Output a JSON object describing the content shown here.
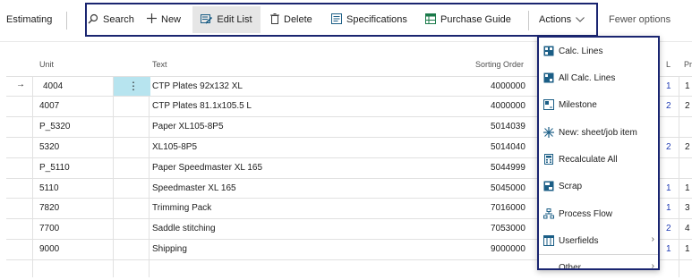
{
  "page": {
    "title": "Estimating"
  },
  "toolbar": {
    "search": "Search",
    "new": "New",
    "edit_list": "Edit List",
    "delete": "Delete",
    "specifications": "Specifications",
    "purchase_guide": "Purchase Guide",
    "actions": "Actions",
    "fewer_options": "Fewer options"
  },
  "columns": {
    "unit": "Unit",
    "text": "Text",
    "sorting_order": "Sorting Order",
    "partial_1": "L",
    "partial_2": "Pr"
  },
  "rows": [
    {
      "arrow": "→",
      "unit": "4004",
      "text": "CTP Plates 92x132 XL",
      "sort": "4000000",
      "c1": "1",
      "c2": "1"
    },
    {
      "arrow": "",
      "unit": "4007",
      "text": "CTP Plates 81.1x105.5 L",
      "sort": "4000000",
      "c1": "2",
      "c2": "2"
    },
    {
      "arrow": "",
      "unit": "P_5320",
      "text": "Paper XL105-8P5",
      "sort": "5014039",
      "c1": "",
      "c2": ""
    },
    {
      "arrow": "",
      "unit": "5320",
      "text": "XL105-8P5",
      "sort": "5014040",
      "c1": "2",
      "c2": "2"
    },
    {
      "arrow": "",
      "unit": "P_5110",
      "text": "Paper Speedmaster XL 165",
      "sort": "5044999",
      "c1": "",
      "c2": ""
    },
    {
      "arrow": "",
      "unit": "5110",
      "text": "Speedmaster XL 165",
      "sort": "5045000",
      "c1": "1",
      "c2": "1"
    },
    {
      "arrow": "",
      "unit": "7820",
      "text": "Trimming Pack",
      "sort": "7016000",
      "c1": "1",
      "c2": "3"
    },
    {
      "arrow": "",
      "unit": "7700",
      "text": "Saddle stitching",
      "sort": "7053000",
      "c1": "2",
      "c2": "4"
    },
    {
      "arrow": "",
      "unit": "9000",
      "text": "Shipping",
      "sort": "9000000",
      "c1": "1",
      "c2": "1"
    }
  ],
  "row_actions_glyph": "⋮",
  "actions_menu": {
    "items": [
      {
        "label": "Calc. Lines",
        "icon": "calc-lines-icon"
      },
      {
        "label": "All Calc. Lines",
        "icon": "all-calc-lines-icon"
      },
      {
        "label": "Milestone",
        "icon": "milestone-icon"
      },
      {
        "label": "New: sheet/job item",
        "icon": "new-sheet-icon"
      },
      {
        "label": "Recalculate All",
        "icon": "recalculate-icon"
      },
      {
        "label": "Scrap",
        "icon": "scrap-icon"
      },
      {
        "label": "Process Flow",
        "icon": "process-flow-icon"
      },
      {
        "label": "Userfields",
        "icon": "userfields-icon"
      },
      {
        "label": "Other",
        "icon": ""
      }
    ],
    "chevron": "›"
  },
  "colors": {
    "accent": "#1a2570",
    "selection": "#b7e4ef",
    "link_blue": "#1f3bb3"
  }
}
